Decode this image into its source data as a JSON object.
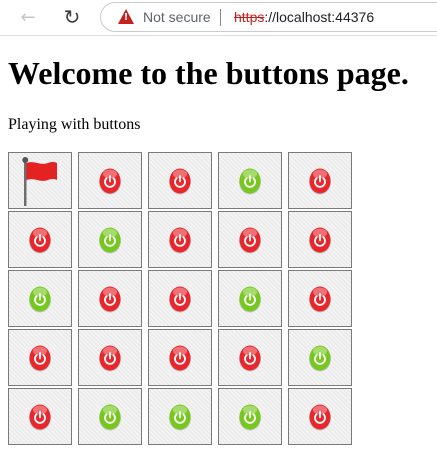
{
  "browser": {
    "back_glyph": "←",
    "reload_glyph": "↻",
    "security_text": "Not secure",
    "url_scheme": "https",
    "url_rest": "://localhost:44376"
  },
  "page": {
    "title": "Welcome to the buttons page.",
    "subtitle": "Playing with buttons"
  },
  "colors": {
    "red_button": "#e8262b",
    "green_button": "#76c81e",
    "flag": "#e42222"
  },
  "grid": {
    "rows": 5,
    "cols": 5,
    "cells": [
      [
        "flag",
        "red",
        "red",
        "green",
        "red"
      ],
      [
        "red",
        "green",
        "red",
        "red",
        "red"
      ],
      [
        "green",
        "red",
        "red",
        "green",
        "red"
      ],
      [
        "red",
        "red",
        "red",
        "red",
        "green"
      ],
      [
        "red",
        "green",
        "green",
        "green",
        "red"
      ]
    ]
  }
}
